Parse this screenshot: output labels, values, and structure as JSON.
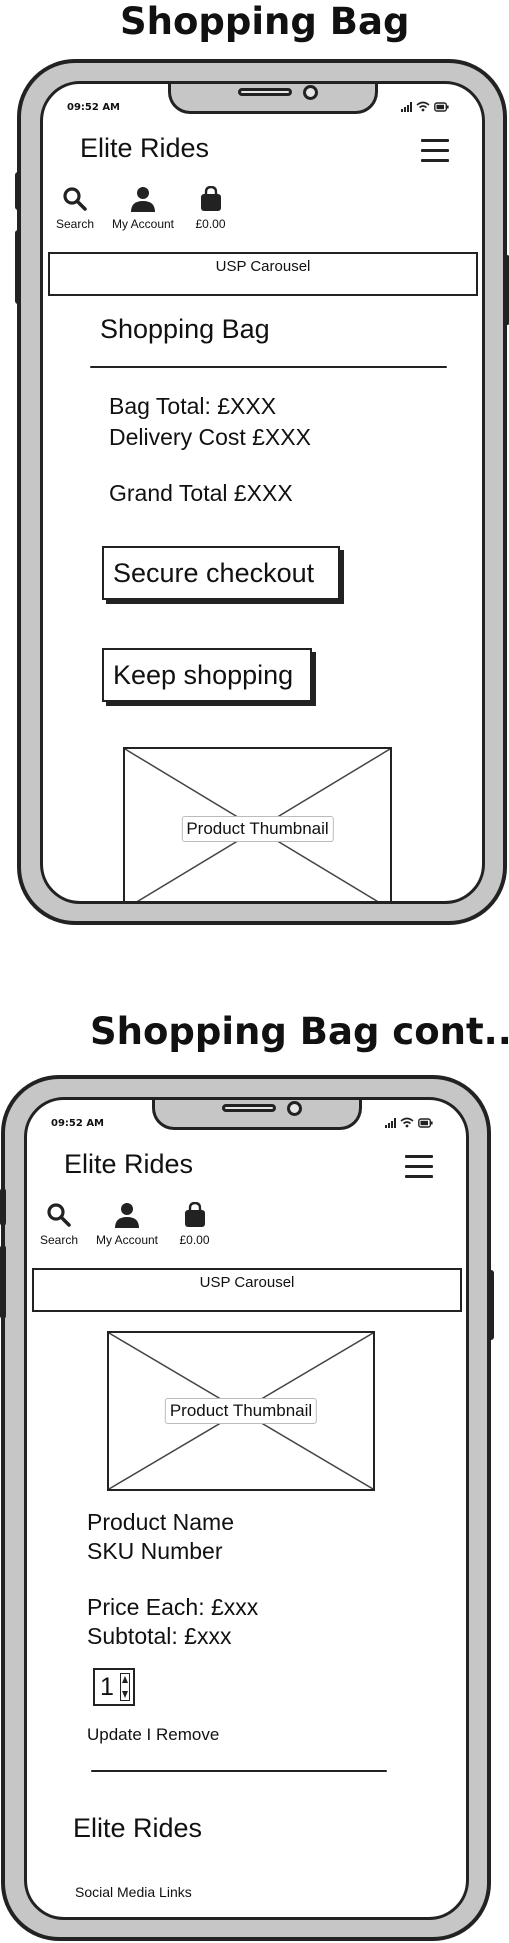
{
  "screens": [
    {
      "heading": "Shopping Bag",
      "status": {
        "time": "09:52 AM"
      },
      "header": {
        "brand": "Elite Rides"
      },
      "nav": {
        "search": "Search",
        "account": "My Account",
        "bag": "£0.00"
      },
      "usp": "USP Carousel",
      "page_title": "Shopping Bag",
      "totals": {
        "bag_total": "Bag Total: £XXX",
        "delivery": "Delivery Cost £XXX",
        "grand_total": "Grand Total £XXX"
      },
      "buttons": {
        "checkout": "Secure checkout",
        "keep_shopping": "Keep shopping"
      },
      "thumbnail": "Product Thumbnail"
    },
    {
      "heading": "Shopping Bag cont...",
      "status": {
        "time": "09:52 AM"
      },
      "header": {
        "brand": "Elite Rides"
      },
      "nav": {
        "search": "Search",
        "account": "My Account",
        "bag": "£0.00"
      },
      "usp": "USP Carousel",
      "thumbnail": "Product Thumbnail",
      "product": {
        "name": "Product Name",
        "sku": "SKU Number",
        "price_each": "Price Each: £xxx",
        "subtotal": "Subtotal: £xxx",
        "quantity": "1",
        "actions": "Update I Remove"
      },
      "footer": {
        "brand": "Elite Rides",
        "social": "Social Media Links"
      }
    }
  ],
  "icons": [
    "search-icon",
    "user-icon",
    "bag-icon",
    "hamburger-icon",
    "signal-icon",
    "wifi-icon",
    "battery-icon"
  ]
}
